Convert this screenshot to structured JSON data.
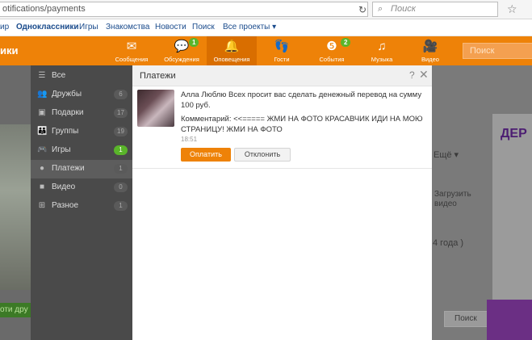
{
  "browser": {
    "url": "otifications/payments",
    "search_placeholder": "Поиск"
  },
  "bookmarks": [
    {
      "label": "ир"
    },
    {
      "label": "Одноклассники"
    },
    {
      "label": "Игры"
    },
    {
      "label": "Знакомства"
    },
    {
      "label": "Новости"
    },
    {
      "label": "Поиск"
    },
    {
      "label": "Все проекты ▾"
    }
  ],
  "topbar": {
    "logo": "ики",
    "search_placeholder": "Поиск",
    "nav": [
      {
        "label": "Сообщения",
        "icon": "envelope-icon",
        "badge": ""
      },
      {
        "label": "Обсуждения",
        "icon": "chat-icon",
        "badge": "1"
      },
      {
        "label": "Оповещения",
        "icon": "bell-icon",
        "badge": ""
      },
      {
        "label": "Гости",
        "icon": "footprints-icon",
        "badge": ""
      },
      {
        "label": "События",
        "icon": "events-icon",
        "badge": "2"
      },
      {
        "label": "Музыка",
        "icon": "music-icon",
        "badge": ""
      },
      {
        "label": "Видео",
        "icon": "video-icon",
        "badge": ""
      }
    ]
  },
  "menu": {
    "items": [
      {
        "label": "Все",
        "count": ""
      },
      {
        "label": "Дружбы",
        "count": "6"
      },
      {
        "label": "Подарки",
        "count": "17"
      },
      {
        "label": "Группы",
        "count": "19"
      },
      {
        "label": "Игры",
        "count": "1"
      },
      {
        "label": "Платежи",
        "count": "1"
      },
      {
        "label": "Видео",
        "count": "0"
      },
      {
        "label": "Разное",
        "count": "1"
      }
    ]
  },
  "background": {
    "left_text": "оти дру",
    "right_more": "Ещё ▾",
    "right_upload": "Загрузить",
    "right_video": "видео",
    "right_year": "4 года )",
    "right_banner": "ДЕР",
    "right_search": "Поиск"
  },
  "modal": {
    "title": "Платежи",
    "help": "?",
    "notification": {
      "text": "Алла Люблю Всех просит вас сделать денежный перевод на сумму 100 руб.",
      "comment": "Комментарий: <<===== ЖМИ НА ФОТО КРАСАВЧИК ИДИ НА МОЮ СТРАНИЦУ! ЖМИ НА ФОТО",
      "time": "18:51",
      "pay_label": "Оплатить",
      "decline_label": "Отклонить"
    }
  }
}
